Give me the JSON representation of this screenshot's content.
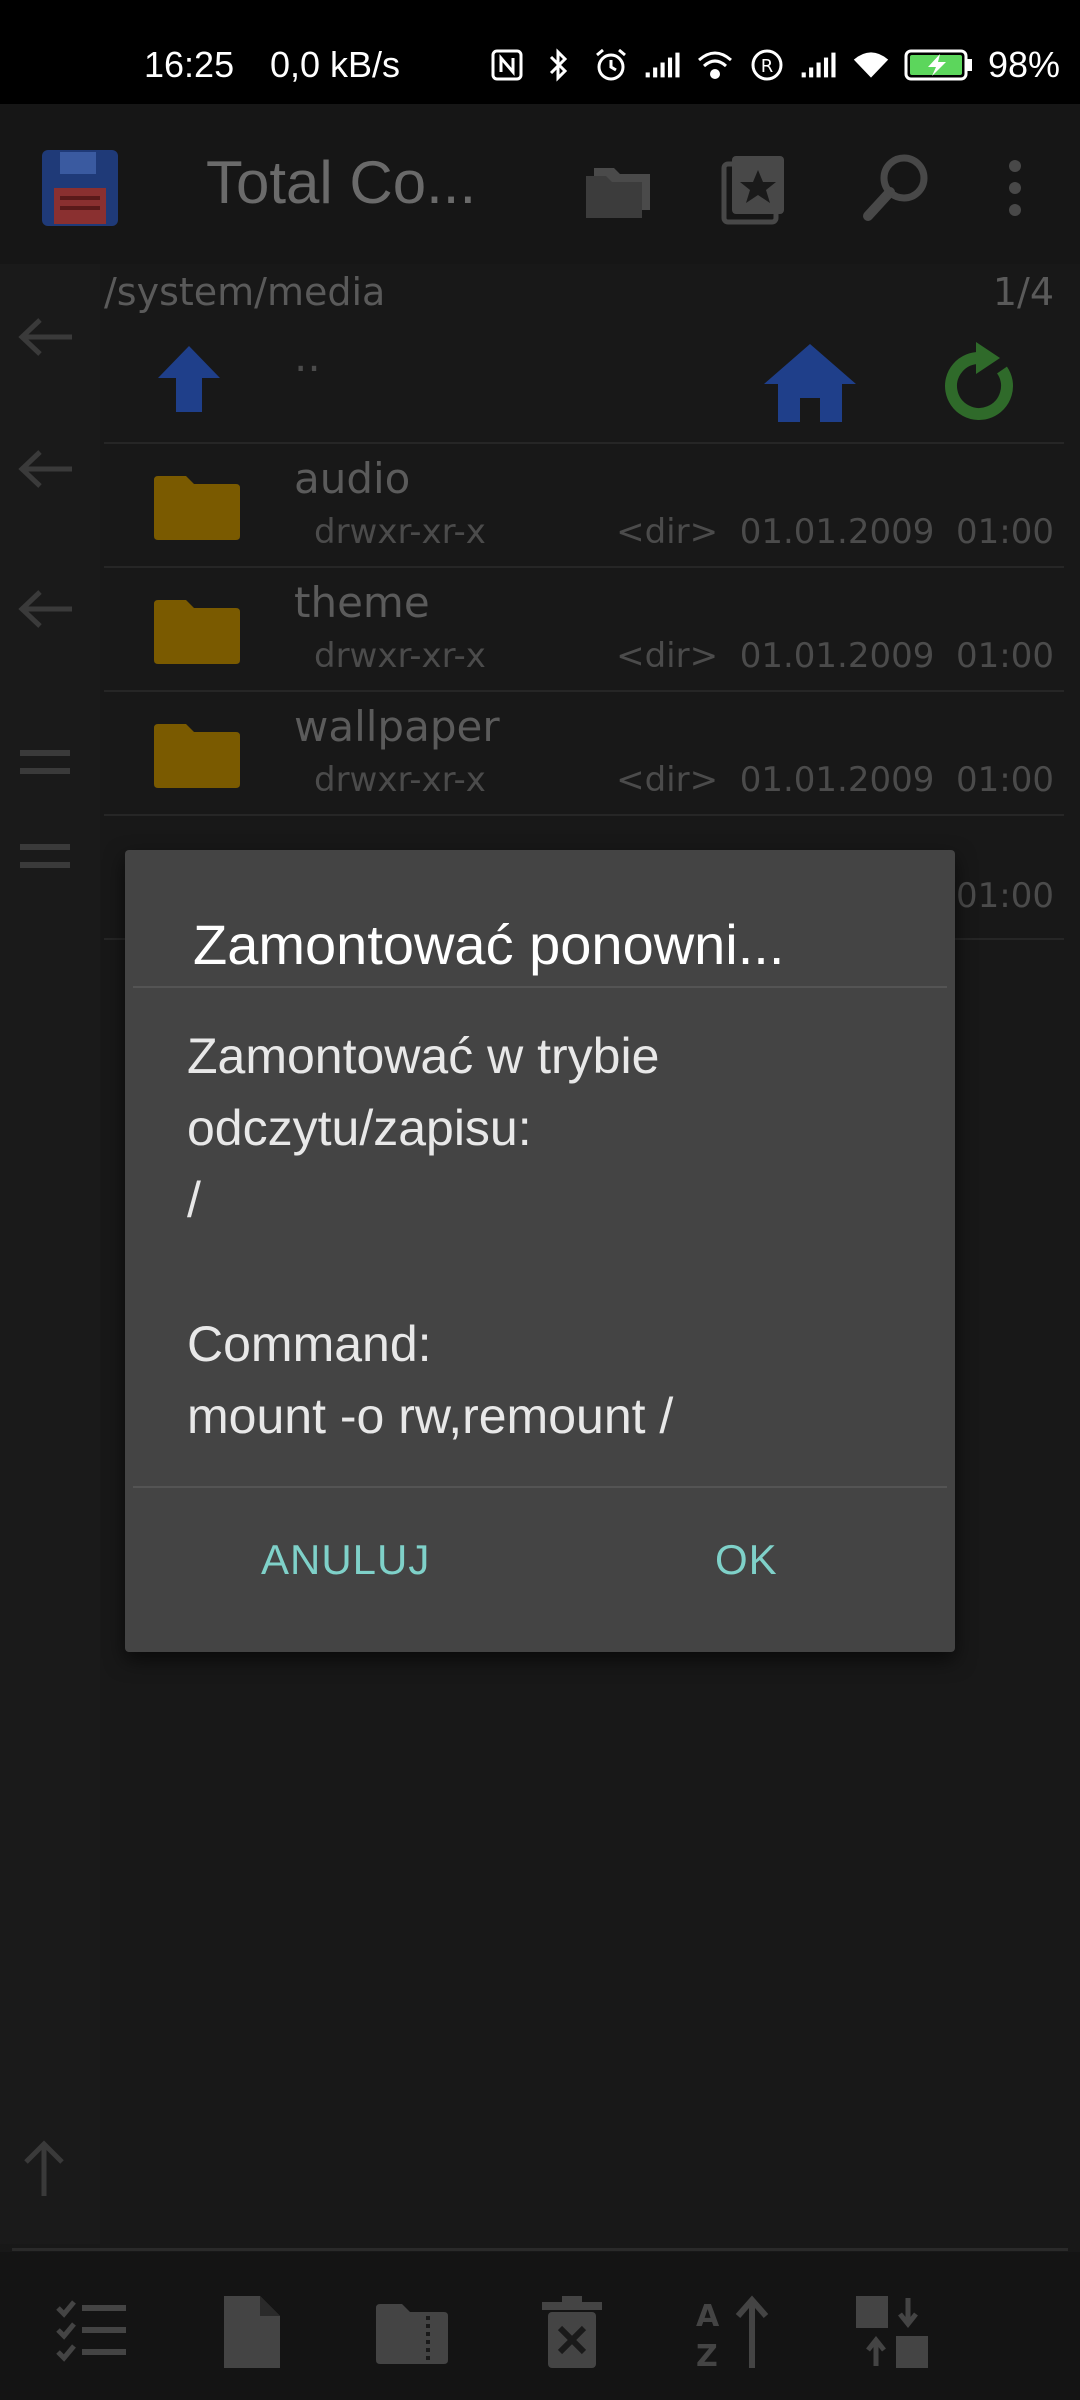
{
  "status_bar": {
    "time": "16:25",
    "net_speed": "0,0 kB/s",
    "battery": "98%",
    "icons": [
      "nfc-icon",
      "bluetooth-icon",
      "alarm-icon",
      "signal-icon",
      "wifi-calling-icon",
      "roaming-icon",
      "signal-2-icon",
      "wifi-icon",
      "battery-charging-icon"
    ]
  },
  "app_bar": {
    "title": "Total Co...",
    "icons": [
      "floppy-disk-icon",
      "folders-icon",
      "bookmark-star-icon",
      "search-icon",
      "more-vert-icon"
    ]
  },
  "panel": {
    "path": "/system/media",
    "page_indicator": "1/4",
    "up_label": "..",
    "rows": [
      {
        "name": "audio",
        "perm": "drwxr-xr-x",
        "type": "<dir>",
        "date": "01.01.2009",
        "time": "01:00"
      },
      {
        "name": "theme",
        "perm": "drwxr-xr-x",
        "type": "<dir>",
        "date": "01.01.2009",
        "time": "01:00"
      },
      {
        "name": "wallpaper",
        "perm": "drwxr-xr-x",
        "type": "<dir>",
        "date": "01.01.2009",
        "time": "01:00"
      }
    ],
    "partial_row_time": "01:00"
  },
  "dialog": {
    "title": "Zamontować ponowni...",
    "body": "Zamontować w trybie\nodczytu/zapisu:\n/\n\nCommand:\nmount -o rw,remount /",
    "cancel_label": "ANULUJ",
    "ok_label": "OK"
  },
  "bottom_bar": {
    "icons": [
      "select-list-icon",
      "new-file-icon",
      "zip-folder-icon",
      "delete-icon",
      "sort-az-icon",
      "swap-panels-icon"
    ]
  },
  "colors": {
    "accent": "#7fd1c9",
    "dialog_bg": "#444444",
    "folder": "#7a5a00",
    "up_arrow": "#1f3f8a",
    "refresh": "#2f6a2a"
  }
}
